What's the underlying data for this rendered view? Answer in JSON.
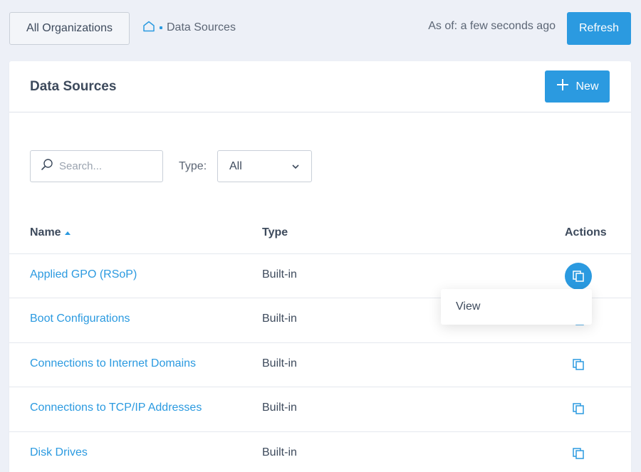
{
  "topbar": {
    "org_button": "All Organizations",
    "breadcrumb": "Data Sources",
    "as_of": "As of: a few seconds ago",
    "refresh": "Refresh"
  },
  "card": {
    "title": "Data Sources",
    "new_button": "New"
  },
  "filters": {
    "search_placeholder": "Search...",
    "type_label": "Type:",
    "type_value": "All"
  },
  "table": {
    "headers": {
      "name": "Name",
      "type": "Type",
      "actions": "Actions"
    },
    "rows": [
      {
        "name": "Applied GPO (RSoP)",
        "type": "Built-in"
      },
      {
        "name": "Boot Configurations",
        "type": "Built-in"
      },
      {
        "name": "Connections to Internet Domains",
        "type": "Built-in"
      },
      {
        "name": "Connections to TCP/IP Addresses",
        "type": "Built-in"
      },
      {
        "name": "Disk Drives",
        "type": "Built-in"
      }
    ]
  },
  "context_menu": {
    "view": "View"
  },
  "colors": {
    "accent": "#2b9ae0",
    "background": "#edf0f7",
    "text": "#3d4a5c"
  }
}
